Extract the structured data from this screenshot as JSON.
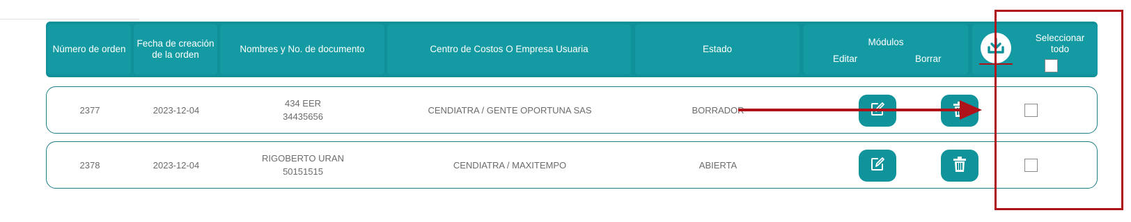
{
  "table": {
    "headers": {
      "order_number": "Número de orden",
      "creation_date_line1": "Fecha de creación",
      "creation_date_line2": "de la orden",
      "names_document": "Nombres y No. de documento",
      "cost_center": "Centro de Costos O Empresa Usuaria",
      "status": "Estado",
      "modules": "Módulos",
      "edit": "Editar",
      "delete": "Borrar",
      "select_all_line1": "Seleccionar",
      "select_all_line2": "todo"
    },
    "rows": [
      {
        "order": "2377",
        "date": "2023-12-04",
        "name": "434 EER",
        "document": "34435656",
        "center": "CENDIATRA / GENTE OPORTUNA SAS",
        "status": "BORRADOR",
        "selected": false
      },
      {
        "order": "2378",
        "date": "2023-12-04",
        "name": "RIGOBERTO URAN",
        "document": "50151515",
        "center": "CENDIATRA / MAXITEMPO",
        "status": "ABIERTA",
        "selected": false
      }
    ]
  },
  "icons": {
    "download": "download-icon",
    "edit": "edit-icon",
    "delete": "trash-icon"
  },
  "colors": {
    "primary": "#10919a",
    "header_cell": "#139aa3",
    "annotation": "#b0121a"
  }
}
